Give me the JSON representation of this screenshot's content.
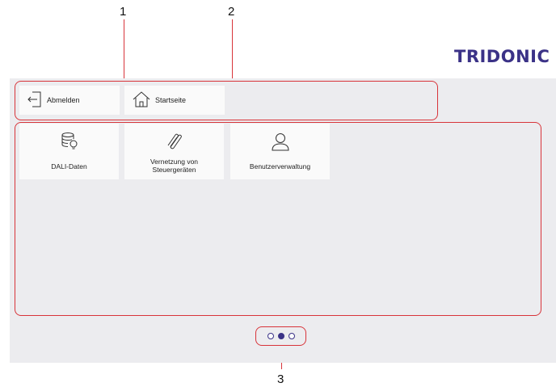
{
  "callouts": [
    "1",
    "2",
    "3"
  ],
  "brand": "TRIDONIC",
  "topbar": {
    "logout_label": "Abmelden",
    "home_label": "Startseite"
  },
  "apps": [
    {
      "label": "DALI-Daten",
      "icon": "database-bulb-icon"
    },
    {
      "label_line1": "Vernetzung von",
      "label_line2": "Steuergeräten",
      "icon": "paperclip-icon"
    },
    {
      "label": "Benutzerverwaltung",
      "icon": "user-icon"
    }
  ],
  "pagination": {
    "pages": 3,
    "current": 2
  },
  "colors": {
    "brand": "#3b3287",
    "callout": "#d8343a",
    "screen_bg": "#ececef"
  }
}
